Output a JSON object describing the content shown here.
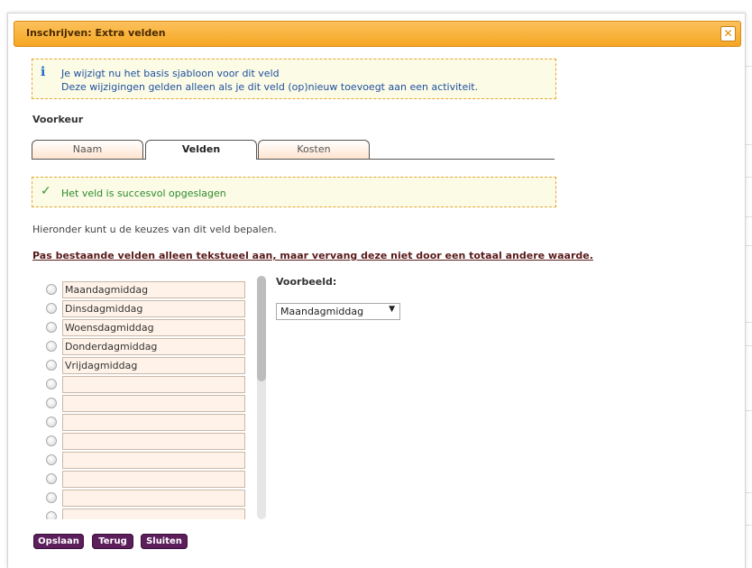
{
  "dialog": {
    "title": "Inschrijven: Extra velden",
    "close_label": "✕"
  },
  "info": {
    "icon": "info-icon",
    "line1": "Je wijzigt nu het basis sjabloon voor dit veld",
    "line2": "Deze wijzigingen gelden alleen als je dit veld (op)nieuw toevoegt aan een activiteit."
  },
  "preference_label": "Voorkeur",
  "tabs": [
    {
      "label": "Naam"
    },
    {
      "label": "Velden"
    },
    {
      "label": "Kosten"
    }
  ],
  "active_tab": "Velden",
  "success": {
    "icon": "check-icon",
    "message": "Het veld is succesvol opgeslagen"
  },
  "description": "Hieronder kunt u de keuzes van dit veld bepalen.",
  "warning": "Pas bestaande velden alleen tekstueel aan, maar vervang deze niet door een totaal andere waarde.",
  "choices": [
    "Maandagmiddag",
    "Dinsdagmiddag",
    "Woensdagmiddag",
    "Donderdagmiddag",
    "Vrijdagmiddag",
    "",
    "",
    "",
    "",
    "",
    "",
    "",
    ""
  ],
  "preview": {
    "label": "Voorbeeld:",
    "selected": "Maandagmiddag",
    "arrow": "▼"
  },
  "buttons": {
    "save": "Opslaan",
    "back": "Terug",
    "close": "Sluiten"
  },
  "colors": {
    "title_bar": "#f5a623",
    "notice_bg": "#fbfbe6",
    "notice_border": "#e8a52d",
    "button_bg": "#5c1f5c",
    "field_bg": "#fff2e8"
  }
}
